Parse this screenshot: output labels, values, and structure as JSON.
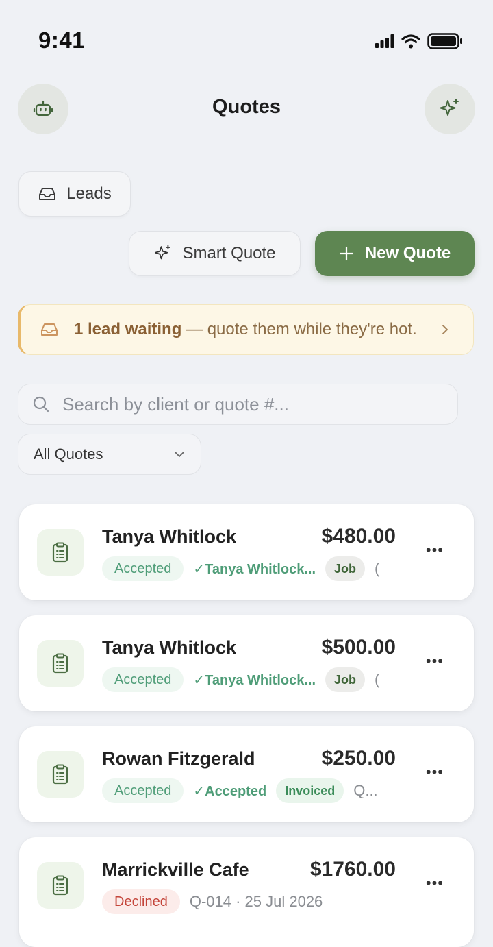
{
  "status_bar": {
    "time": "9:41"
  },
  "header": {
    "title": "Quotes"
  },
  "actions": {
    "leads_label": "Leads",
    "smart_quote_label": "Smart Quote",
    "new_quote_label": "New Quote"
  },
  "banner": {
    "strong": "1 lead waiting",
    "rest": " — quote them while they're hot."
  },
  "search": {
    "placeholder": "Search by client or quote #..."
  },
  "filter": {
    "selected": "All Quotes"
  },
  "colors": {
    "primary": "#5e8652",
    "accepted": "#4f9d78",
    "declined": "#c4453a",
    "banner": "#fdf7e6"
  },
  "quotes": [
    {
      "client": "Tanya Whitlock",
      "amount": "$480.00",
      "status": "Accepted",
      "accepted_by": "✓Tanya Whitlock...",
      "tag": "Job",
      "trail": "("
    },
    {
      "client": "Tanya Whitlock",
      "amount": "$500.00",
      "status": "Accepted",
      "accepted_by": "✓Tanya Whitlock...",
      "tag": "Job",
      "trail": "("
    },
    {
      "client": "Rowan Fitzgerald",
      "amount": "$250.00",
      "status": "Accepted",
      "accepted_by": "✓Accepted",
      "tag": "Invoiced",
      "trail": "Q..."
    },
    {
      "client": "Marrickville Cafe",
      "amount": "$1760.00",
      "status": "Declined",
      "detail": "Q-014 · 25 Jul 2026"
    }
  ]
}
